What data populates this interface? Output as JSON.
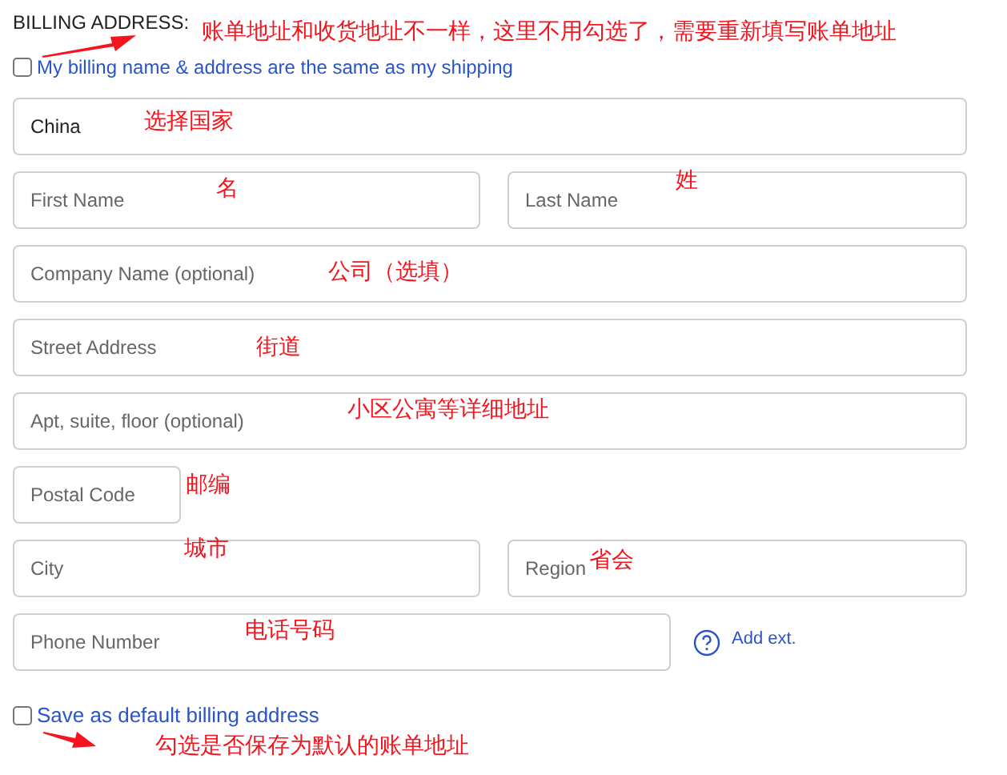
{
  "heading": "BILLING ADDRESS:",
  "heading_note": "账单地址和收货地址不一样，这里不用勾选了，需要重新填写账单地址",
  "same_as_shipping": {
    "label": "My billing name & address are the same as my shipping",
    "checked": false
  },
  "rows": [
    {
      "fields": [
        {
          "value": "China",
          "note": "选择国家"
        }
      ]
    },
    {
      "fields": [
        {
          "placeholder": "First Name",
          "note": "名"
        },
        {
          "placeholder": "Last Name",
          "note": "姓"
        }
      ]
    },
    {
      "fields": [
        {
          "placeholder": "Company Name (optional)",
          "note": "公司（选填）"
        }
      ]
    },
    {
      "fields": [
        {
          "placeholder": "Street Address",
          "note": "街道"
        }
      ]
    },
    {
      "fields": [
        {
          "placeholder": "Apt, suite, floor (optional)",
          "note": "小区公寓等详细地址"
        }
      ]
    },
    {
      "fields": [
        {
          "placeholder": "Postal Code",
          "note": "邮编"
        }
      ]
    },
    {
      "fields": [
        {
          "placeholder": "City",
          "note": "城市"
        },
        {
          "placeholder": "Region",
          "note": "省会"
        }
      ]
    },
    {
      "fields": [
        {
          "placeholder": "Phone Number",
          "note": "电话号码"
        }
      ],
      "link": "Add ext."
    }
  ],
  "save_default": {
    "label": "Save as default billing address",
    "checked": false
  },
  "save_note": "勾选是否保存为默认的账单地址"
}
